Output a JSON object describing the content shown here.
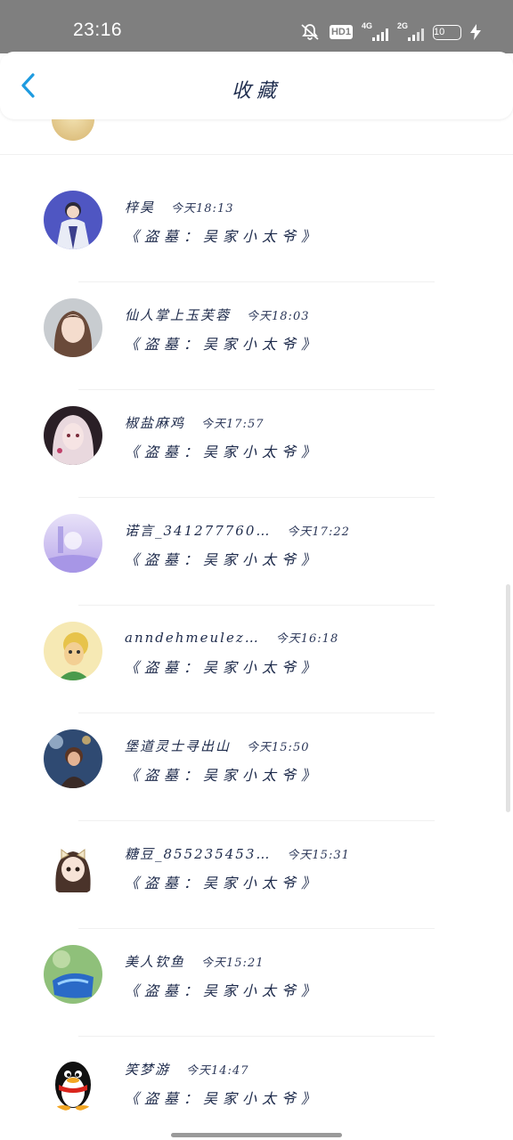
{
  "status_bar": {
    "time": "23:16",
    "hd_label": "HD1",
    "net1_label": "4G",
    "net2_label": "2G",
    "battery": "10",
    "color": "#7f7f7f"
  },
  "nav": {
    "back_icon": "chevron-left-icon",
    "title": "收藏",
    "accent": "#1e9be0"
  },
  "items": [
    {
      "name": "梓昊",
      "time": "今天18:13",
      "book": "《盗墓：吴家小太爷》"
    },
    {
      "name": "仙人掌上玉芙蓉",
      "time": "今天18:03",
      "book": "《盗墓：吴家小太爷》"
    },
    {
      "name": "椒盐麻鸡",
      "time": "今天17:57",
      "book": "《盗墓：吴家小太爷》"
    },
    {
      "name": "诺言_341277760…",
      "time": "今天17:22",
      "book": "《盗墓：吴家小太爷》"
    },
    {
      "name": "anndehmeulez…",
      "time": "今天16:18",
      "book": "《盗墓：吴家小太爷》"
    },
    {
      "name": "堡道灵士寻出山",
      "time": "今天15:50",
      "book": "《盗墓：吴家小太爷》"
    },
    {
      "name": "糖豆_855235453…",
      "time": "今天15:31",
      "book": "《盗墓：吴家小太爷》"
    },
    {
      "name": "美人钦鱼",
      "time": "今天15:21",
      "book": "《盗墓：吴家小太爷》"
    },
    {
      "name": "笑梦游",
      "time": "今天14:47",
      "book": "《盗墓：吴家小太爷》"
    }
  ]
}
